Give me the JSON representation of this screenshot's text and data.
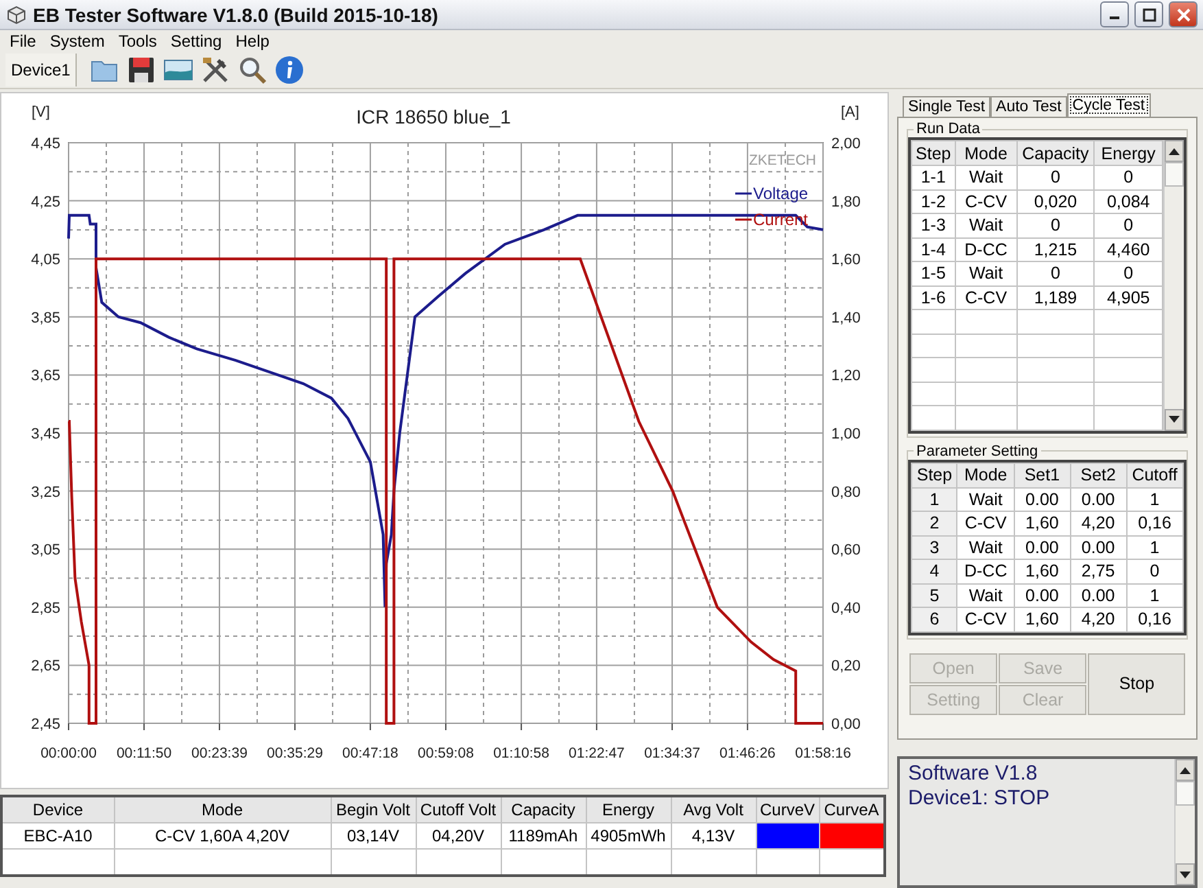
{
  "window": {
    "title": "EB Tester Software V1.8.0 (Build 2015-10-18)"
  },
  "menu": [
    "File",
    "System",
    "Tools",
    "Setting",
    "Help"
  ],
  "toolbar": {
    "device_tab": "Device1"
  },
  "chart": {
    "watermark": "ZKETECH",
    "left_unit": "[V]",
    "right_unit": "[A]",
    "chart_data": {
      "type": "line",
      "title": "ICR 18650 blue_1",
      "grid": true,
      "legend": "upper right",
      "xlim": [
        0,
        118.27
      ],
      "ylim": [
        2.45,
        4.45
      ],
      "y2lim": [
        0,
        2
      ],
      "y2ticks": [
        {
          "value": 0,
          "label": "0,00"
        },
        {
          "value": 0.2,
          "label": "0,20"
        },
        {
          "value": 0.4,
          "label": "0,40"
        },
        {
          "value": 0.6,
          "label": "0,60"
        },
        {
          "value": 0.8,
          "label": "0,80"
        },
        {
          "value": 1,
          "label": "1,00"
        },
        {
          "value": 1.2,
          "label": "1,20"
        },
        {
          "value": 1.4,
          "label": "1,40"
        },
        {
          "value": 1.6,
          "label": "1,60"
        },
        {
          "value": 1.8,
          "label": "1,80"
        },
        {
          "value": 2,
          "label": "2,00"
        }
      ],
      "xticks": [
        {
          "value": 0,
          "label": "00:00:00"
        },
        {
          "value": 11.83,
          "label": "00:11:50"
        },
        {
          "value": 23.65,
          "label": "00:23:39"
        },
        {
          "value": 35.48,
          "label": "00:35:29"
        },
        {
          "value": 47.3,
          "label": "00:47:18"
        },
        {
          "value": 59.13,
          "label": "00:59:08"
        },
        {
          "value": 70.97,
          "label": "01:10:58"
        },
        {
          "value": 82.78,
          "label": "01:22:47"
        },
        {
          "value": 94.62,
          "label": "01:34:37"
        },
        {
          "value": 106.43,
          "label": "01:46:26"
        },
        {
          "value": 118.27,
          "label": "01:58:16"
        }
      ],
      "yticks": [
        {
          "value": 2.45,
          "label": "2,45"
        },
        {
          "value": 2.65,
          "label": "2,65"
        },
        {
          "value": 2.85,
          "label": "2,85"
        },
        {
          "value": 3.05,
          "label": "3,05"
        },
        {
          "value": 3.25,
          "label": "3,25"
        },
        {
          "value": 3.45,
          "label": "3,45"
        },
        {
          "value": 3.65,
          "label": "3,65"
        },
        {
          "value": 3.85,
          "label": "3,85"
        },
        {
          "value": 4.05,
          "label": "4,05"
        },
        {
          "value": 4.25,
          "label": "4,25"
        },
        {
          "value": 4.45,
          "label": "4,45"
        }
      ],
      "x": [
        0,
        0.1,
        0.5,
        1,
        2,
        3.2,
        3.2,
        3.4,
        4.3,
        4.3,
        5.2,
        7.8,
        11.3,
        15.7,
        20.1,
        26.2,
        31.5,
        36.8,
        41.2,
        43.8,
        47.3,
        49.3,
        49.6,
        49.8,
        49.8,
        50.6,
        51.0,
        51.0,
        51.9,
        54.3,
        57.9,
        62.2,
        68.4,
        74.5,
        79.8,
        80.2,
        89.4,
        94.7,
        101.7,
        107,
        110.5,
        114,
        114,
        115.8,
        118.27
      ],
      "series": [
        {
          "name": "Voltage",
          "color": "#1c1c8c",
          "values": [
            4.12,
            4.2,
            4.2,
            4.2,
            4.2,
            4.2,
            4.2,
            4.17,
            4.17,
            4.02,
            3.9,
            3.85,
            3.83,
            3.78,
            3.74,
            3.7,
            3.66,
            3.62,
            3.57,
            3.5,
            3.35,
            3.1,
            2.85,
            3.0,
            3.0,
            3.1,
            3.25,
            3.25,
            3.45,
            3.85,
            3.92,
            4.0,
            4.1,
            4.15,
            4.2,
            4.2,
            4.2,
            4.2,
            4.2,
            4.2,
            4.2,
            4.2,
            4.2,
            4.16,
            4.15
          ]
        },
        {
          "name": "Current",
          "color": "#b01010",
          "axis": "y2",
          "values": [
            1.04,
            1.04,
            0.78,
            0.5,
            0.35,
            0.2,
            0,
            0,
            0,
            1.6,
            1.6,
            1.6,
            1.6,
            1.6,
            1.6,
            1.6,
            1.6,
            1.6,
            1.6,
            1.6,
            1.6,
            1.6,
            1.6,
            1.6,
            0,
            0,
            0,
            1.6,
            1.6,
            1.6,
            1.6,
            1.6,
            1.6,
            1.6,
            1.6,
            1.6,
            1.04,
            0.8,
            0.4,
            0.28,
            0.22,
            0.18,
            0,
            0,
            0
          ]
        }
      ]
    }
  },
  "summary": {
    "columns": [
      "Device",
      "Mode",
      "Begin Volt",
      "Cutoff Volt",
      "Capacity",
      "Energy",
      "Avg Volt",
      "CurveV",
      "CurveA"
    ],
    "rows": [
      {
        "cells": [
          "EBC-A10",
          "C-CV  1,60A  4,20V",
          "03,14V",
          "04,20V",
          "1189mAh",
          "4905mWh",
          "4,13V"
        ],
        "swatches": [
          {
            "color": "#0000ff"
          },
          {
            "color": "#ff0000"
          }
        ]
      }
    ]
  },
  "side_tabs": [
    {
      "label": "Single Test",
      "selected": false
    },
    {
      "label": "Auto Test",
      "selected": false
    },
    {
      "label": "Cycle Test",
      "selected": true
    }
  ],
  "run_data": {
    "title": "Run Data",
    "columns": [
      "Step",
      "Mode",
      "Capacity",
      "Energy"
    ],
    "rows": [
      [
        "1-1",
        "Wait",
        "0",
        "0"
      ],
      [
        "1-2",
        "C-CV",
        "0,020",
        "0,084"
      ],
      [
        "1-3",
        "Wait",
        "0",
        "0"
      ],
      [
        "1-4",
        "D-CC",
        "1,215",
        "4,460"
      ],
      [
        "1-5",
        "Wait",
        "0",
        "0"
      ],
      [
        "1-6",
        "C-CV",
        "1,189",
        "4,905"
      ]
    ]
  },
  "parameter_setting": {
    "title": "Parameter Setting",
    "columns": [
      "Step",
      "Mode",
      "Set1",
      "Set2",
      "Cutoff"
    ],
    "rows": [
      [
        "1",
        "Wait",
        "0.00",
        "0.00",
        "1"
      ],
      [
        "2",
        "C-CV",
        "1,60",
        "4,20",
        "0,16"
      ],
      [
        "3",
        "Wait",
        "0.00",
        "0.00",
        "1"
      ],
      [
        "4",
        "D-CC",
        "1,60",
        "2,75",
        "0"
      ],
      [
        "5",
        "Wait",
        "0.00",
        "0.00",
        "1"
      ],
      [
        "6",
        "C-CV",
        "1,60",
        "4,20",
        "0,16"
      ]
    ]
  },
  "buttons": [
    {
      "label": "Open",
      "disabled": true
    },
    {
      "label": "Save",
      "disabled": true
    },
    {
      "label": "Setting",
      "disabled": true
    },
    {
      "label": "Clear",
      "disabled": true
    },
    {
      "label": "Stop",
      "disabled": false
    }
  ],
  "log": [
    "Software V1.8",
    "Device1: STOP"
  ]
}
